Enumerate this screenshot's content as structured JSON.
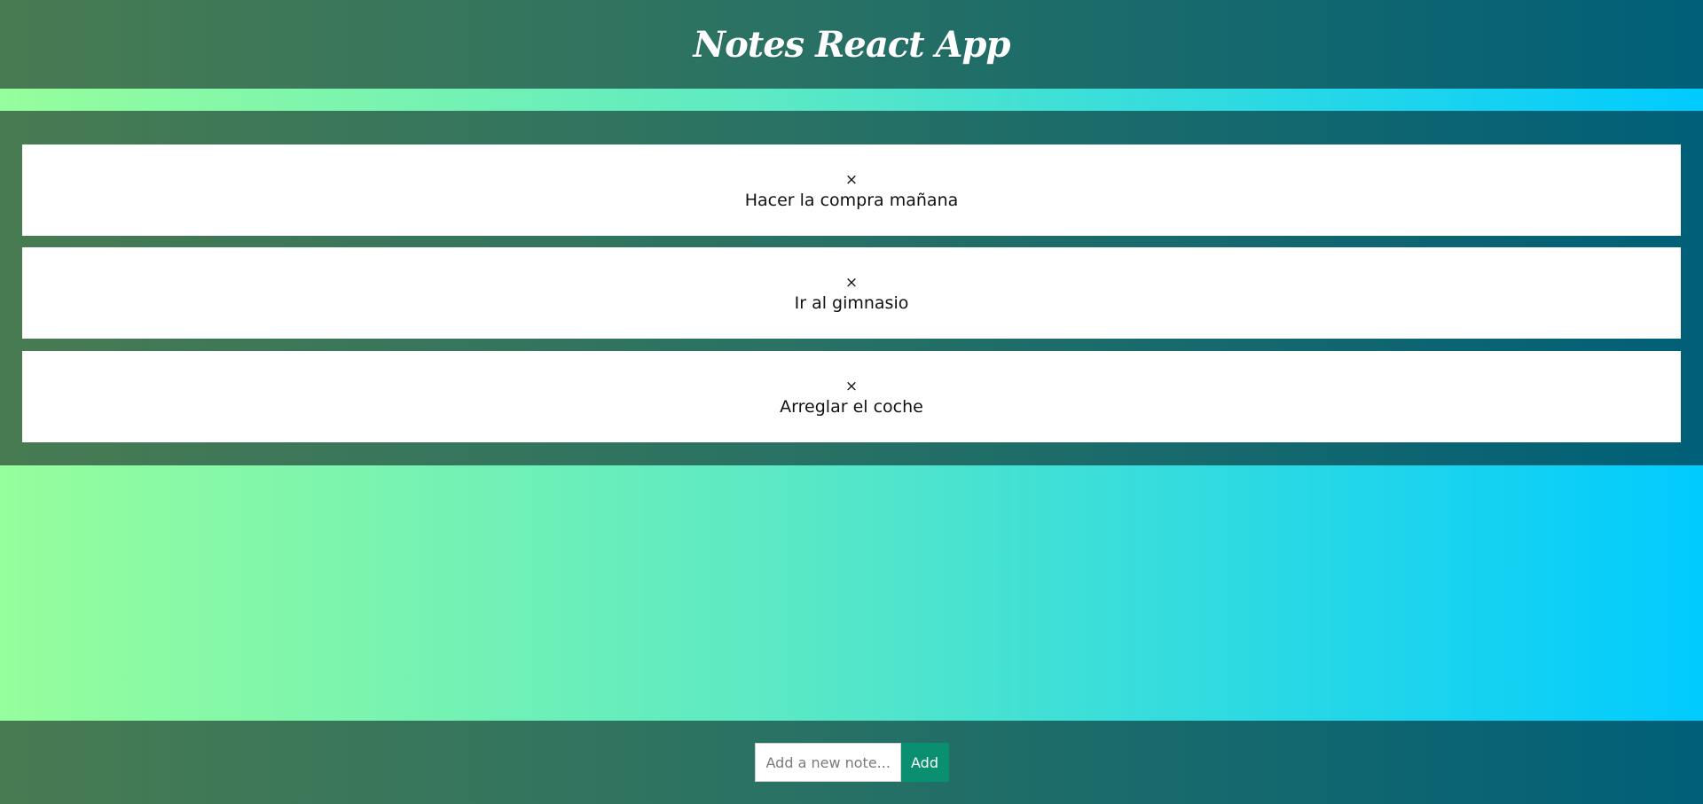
{
  "header": {
    "title": "Notes React App"
  },
  "notes": [
    {
      "delete_glyph": "×",
      "text": "Hacer la compra mañana"
    },
    {
      "delete_glyph": "×",
      "text": "Ir al gimnasio"
    },
    {
      "delete_glyph": "×",
      "text": "Arreglar el coche"
    }
  ],
  "footer": {
    "input_placeholder": "Add a new note...",
    "input_value": "",
    "add_label": "Add"
  },
  "colors": {
    "gradient_light_start": "#96fe9c",
    "gradient_light_end": "#00cbff",
    "gradient_dark_start": "#487b52",
    "gradient_dark_end": "#005f78",
    "add_button": "#0a8f71",
    "card_background": "#ffffff"
  }
}
